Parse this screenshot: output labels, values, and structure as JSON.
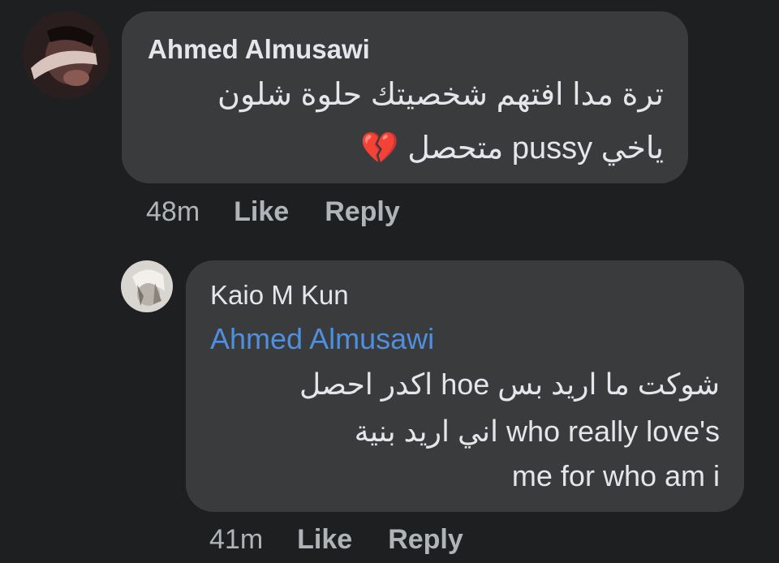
{
  "comments": [
    {
      "author": "Ahmed Almusawi",
      "avatar_icon": "profile-photo-icon",
      "lines": [
        "ترة مدا افتهم شخصيتك حلوة شلون",
        "متحصل pussy ياخي"
      ],
      "emoji": "💔",
      "time": "48m",
      "like_label": "Like",
      "reply_label": "Reply"
    },
    {
      "author": "Kaio M Kun",
      "avatar_icon": "profile-photo-icon",
      "mention": "Ahmed Almusawi",
      "lines": [
        "اكدر احصل hoe شوكت ما اريد بس",
        "اني اريد بنية who really love's",
        "me for who am i"
      ],
      "time": "41m",
      "like_label": "Like",
      "reply_label": "Reply"
    }
  ],
  "colors": {
    "background": "#1e1f21",
    "bubble": "#3a3b3c",
    "text": "#e4e6eb",
    "meta_text": "#b0b3b8",
    "mention": "#4e8fe0"
  }
}
